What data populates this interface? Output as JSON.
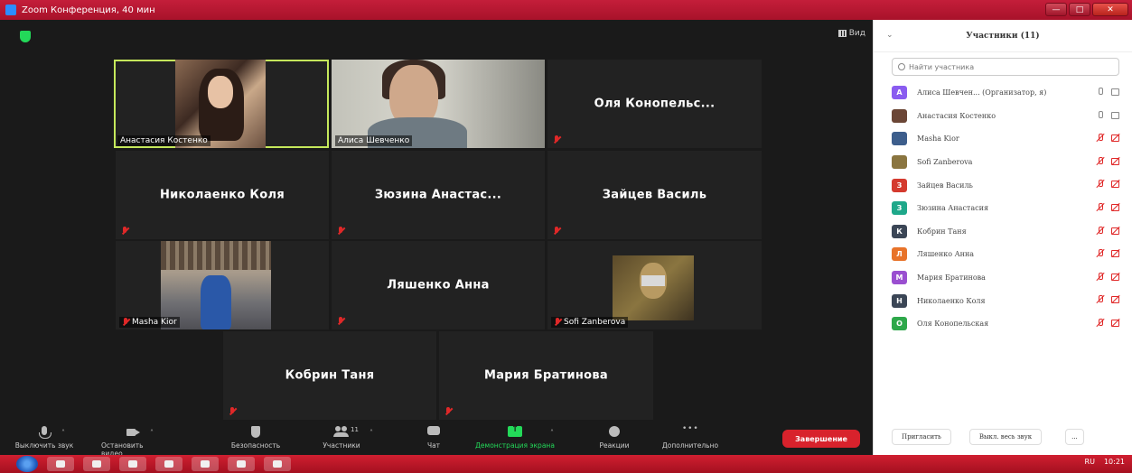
{
  "window": {
    "title": "Zoom Конференция, 40 мин",
    "buttons": {
      "minimize": "—",
      "maximize": "□",
      "close": "✕"
    }
  },
  "meeting": {
    "view_label": "Вид",
    "tiles": [
      {
        "name": "Анастасия Костенко",
        "video": true
      },
      {
        "name": "Алиса Шевченко",
        "video": true
      },
      {
        "name": "Оля Конопельс...",
        "video": false
      },
      {
        "name": "Николаенко Коля",
        "video": false
      },
      {
        "name": "Зюзина Анастас...",
        "video": false
      },
      {
        "name": "Зайцев Василь",
        "video": false
      },
      {
        "name": "Masha Kior",
        "video": true
      },
      {
        "name": "Ляшенко Анна",
        "video": false
      },
      {
        "name": "Sofi Zanberova",
        "video": true
      },
      {
        "name": "Кобрин Таня",
        "video": false
      },
      {
        "name": "Мария Братинова",
        "video": false
      }
    ]
  },
  "toolbar": {
    "mute": "Выключить звук",
    "stop_video": "Остановить видео",
    "security": "Безопасность",
    "participants": "Участники",
    "participants_count": "11",
    "chat": "Чат",
    "share": "Демонстрация экрана",
    "reactions": "Реакции",
    "more": "Дополнительно",
    "end": "Завершение"
  },
  "panel": {
    "title": "Участники (11)",
    "search_placeholder": "Найти участника",
    "participants": [
      {
        "name": "Алиса Шевчен... (Организатор, я)",
        "avatar": "A",
        "color": "#8a5cf0",
        "mic": "on",
        "cam": "on"
      },
      {
        "name": "Анастасия Костенко",
        "avatar": "photo",
        "color": "#6b4636",
        "mic": "on",
        "cam": "on"
      },
      {
        "name": "Masha Kior",
        "avatar": "photo",
        "color": "#3d5e8c",
        "mic": "off",
        "cam": "off"
      },
      {
        "name": "Sofi Zanberova",
        "avatar": "photo",
        "color": "#8a7540",
        "mic": "off",
        "cam": "off"
      },
      {
        "name": "Зайцев Василь",
        "avatar": "З",
        "color": "#d43a2e",
        "mic": "off",
        "cam": "off"
      },
      {
        "name": "Зюзина Анастасия",
        "avatar": "З",
        "color": "#1fa88a",
        "mic": "off",
        "cam": "off"
      },
      {
        "name": "Кобрин Таня",
        "avatar": "К",
        "color": "#3b4656",
        "mic": "off",
        "cam": "off"
      },
      {
        "name": "Ляшенко Анна",
        "avatar": "Л",
        "color": "#e8732a",
        "mic": "off",
        "cam": "off"
      },
      {
        "name": "Мария Братинова",
        "avatar": "М",
        "color": "#9a4fd0",
        "mic": "off",
        "cam": "off"
      },
      {
        "name": "Николаенко Коля",
        "avatar": "Н",
        "color": "#3b4656",
        "mic": "off",
        "cam": "off"
      },
      {
        "name": "Оля Конопельская",
        "avatar": "О",
        "color": "#2ea84a",
        "mic": "off",
        "cam": "off"
      }
    ],
    "invite": "Пригласить",
    "mute_all": "Выкл. весь звук",
    "more": "..."
  },
  "taskbar": {
    "lang": "RU",
    "time": "10:21"
  }
}
